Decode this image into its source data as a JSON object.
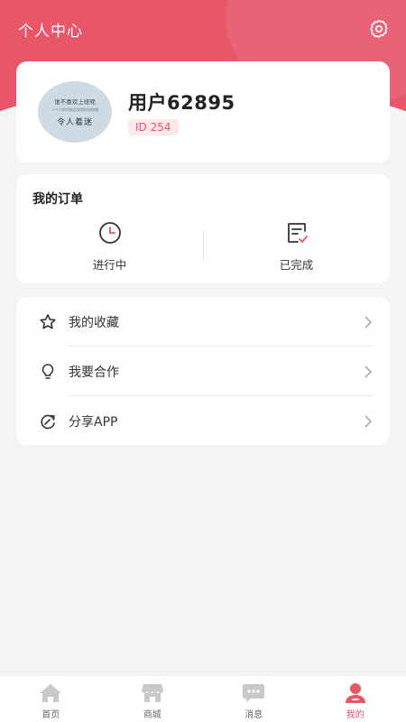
{
  "header": {
    "title": "个人中心"
  },
  "profile": {
    "avatar_text": [
      "谁不喜欢上班呢",
      "一个人的时候总觉得时间很慢",
      "令人着迷"
    ],
    "username": "用户62895",
    "id_label": "ID 254"
  },
  "orders": {
    "title": "我的订单",
    "items": [
      {
        "label": "进行中",
        "icon": "clock-icon"
      },
      {
        "label": "已完成",
        "icon": "checklist-icon"
      }
    ]
  },
  "menu": {
    "items": [
      {
        "label": "我的收藏",
        "icon": "star-icon"
      },
      {
        "label": "我要合作",
        "icon": "lightbulb-icon"
      },
      {
        "label": "分享APP",
        "icon": "share-icon"
      }
    ]
  },
  "tabbar": {
    "items": [
      {
        "label": "首页",
        "icon": "home-icon",
        "active": false
      },
      {
        "label": "商城",
        "icon": "shop-icon",
        "active": false
      },
      {
        "label": "消息",
        "icon": "message-icon",
        "active": false
      },
      {
        "label": "我的",
        "icon": "user-icon",
        "active": true
      }
    ]
  },
  "colors": {
    "accent": "#e8566a",
    "background": "#f3f4f6",
    "card": "#ffffff"
  }
}
